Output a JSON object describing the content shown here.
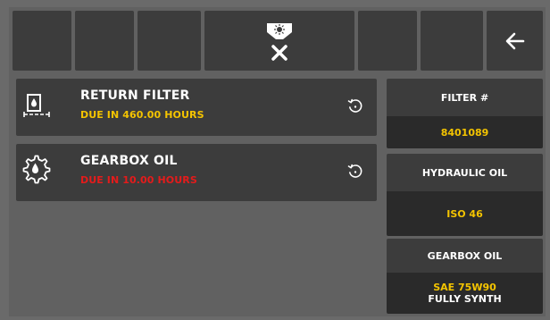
{
  "toolbar": {
    "center_icon": "filter-clear-icon",
    "back_icon": "back-arrow-icon"
  },
  "tasks": [
    {
      "icon": "filter-icon",
      "title": "RETURN FILTER",
      "due": "DUE IN 460.00 HOURS",
      "due_color": "#f4c400",
      "reset_icon": "reset-icon"
    },
    {
      "icon": "gear-oil-icon",
      "title": "GEARBOX OIL",
      "due": "DUE IN 10.00 HOURS",
      "due_color": "#e41b1b",
      "reset_icon": "reset-icon"
    }
  ],
  "info": {
    "filter_number": {
      "label": "FILTER #",
      "value": "8401089"
    },
    "hydraulic_oil": {
      "label": "HYDRAULIC OIL",
      "value": "ISO 46"
    },
    "gearbox_oil": {
      "label": "GEARBOX OIL",
      "value_line1": "SAE 75W90",
      "value_line2": "FULLY SYNTH"
    }
  },
  "colors": {
    "accent_yellow": "#f4c400",
    "alert_red": "#e41b1b",
    "panel": "#3c3c3c",
    "background": "#616161"
  }
}
